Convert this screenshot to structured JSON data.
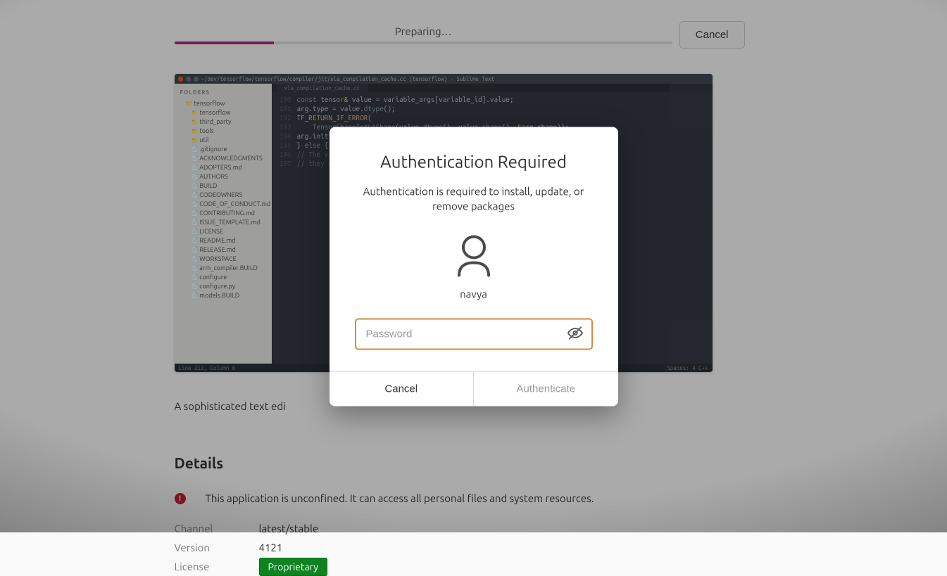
{
  "progress": {
    "label": "Preparing…",
    "cancel_label": "Cancel"
  },
  "cancel_button": "Cancel",
  "screenshot": {
    "window_title": "~/dev/tensorflow/tensorflow/compiler/jit/xla_compilation_cache.cc (tensorflow) - Sublime Text",
    "folders_header": "FOLDERS",
    "tree": [
      {
        "cls": "fld ind1",
        "label": "tensorflow"
      },
      {
        "cls": "fld ind2",
        "label": "tensorflow"
      },
      {
        "cls": "fld ind2",
        "label": "third_party"
      },
      {
        "cls": "fld ind2",
        "label": "tools"
      },
      {
        "cls": "fld ind2",
        "label": "util"
      },
      {
        "cls": "fil ind2",
        "label": ".gitignore"
      },
      {
        "cls": "fil ind2",
        "label": "ACKNOWLEDGMENTS"
      },
      {
        "cls": "fil ind2",
        "label": "ADOPTERS.md"
      },
      {
        "cls": "fil ind2",
        "label": "AUTHORS"
      },
      {
        "cls": "fil ind2",
        "label": "BUILD"
      },
      {
        "cls": "fil ind2",
        "label": "CODEOWNERS"
      },
      {
        "cls": "fil ind2",
        "label": "CODE_OF_CONDUCT.md"
      },
      {
        "cls": "fil ind2",
        "label": "CONTRIBUTING.md"
      },
      {
        "cls": "fil ind2",
        "label": "ISSUE_TEMPLATE.md"
      },
      {
        "cls": "fil ind2",
        "label": "LICENSE"
      },
      {
        "cls": "fil ind2",
        "label": "README.md"
      },
      {
        "cls": "fil ind2",
        "label": "RELEASE.md"
      },
      {
        "cls": "fil ind2",
        "label": "WORKSPACE"
      },
      {
        "cls": "fil ind2",
        "label": "arm_compiler.BUILD"
      },
      {
        "cls": "fil ind2",
        "label": "configure"
      },
      {
        "cls": "fil ind2",
        "label": "configure.py"
      },
      {
        "cls": "fil ind2",
        "label": "models.BUILD"
      }
    ],
    "open_tab": "xla_compilation_cache.cc",
    "status_left": "Line 212, Column 8",
    "status_right": "Spaces: 4    C++"
  },
  "description": "A sophisticated text edi",
  "details": {
    "heading": "Details",
    "warning": "This application is unconfined. It can access all personal files and system resources.",
    "rows": {
      "channel_k": "Channel",
      "channel_v": "latest/stable",
      "version_k": "Version",
      "version_v": "4121",
      "license_k": "License",
      "license_v": "Proprietary"
    }
  },
  "dialog": {
    "title": "Authentication Required",
    "message": "Authentication is required to install, update, or remove packages",
    "username": "navya",
    "password_placeholder": "Password",
    "cancel": "Cancel",
    "authenticate": "Authenticate"
  }
}
